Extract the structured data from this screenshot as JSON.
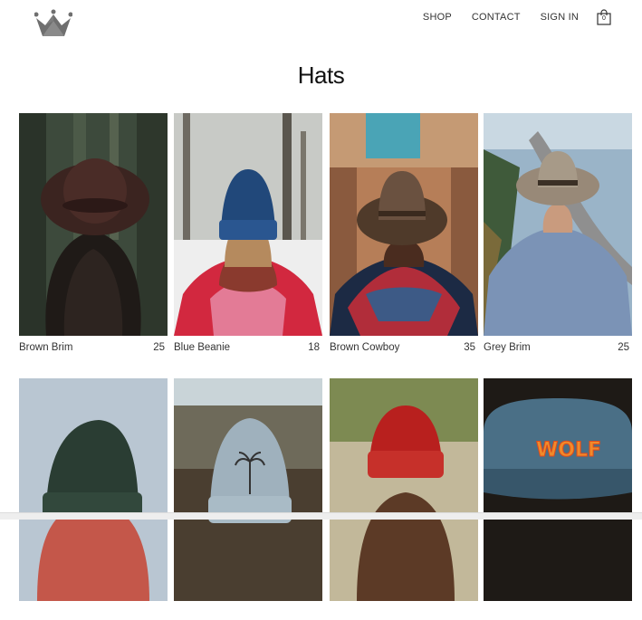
{
  "header": {
    "nav": [
      "SHOP",
      "CONTACT",
      "SIGN IN"
    ],
    "cart_count": "0",
    "logo_icon": "crown-icon",
    "cart_icon": "shopping-bag-icon"
  },
  "page": {
    "title": "Hats"
  },
  "products": [
    {
      "name": "Brown Brim",
      "price": "25"
    },
    {
      "name": "Blue Beanie",
      "price": "18"
    },
    {
      "name": "Brown Cowboy",
      "price": "35"
    },
    {
      "name": "Grey Brim",
      "price": "25"
    },
    {
      "name": "",
      "price": ""
    },
    {
      "name": "",
      "price": ""
    },
    {
      "name": "",
      "price": ""
    },
    {
      "name": "",
      "price": ""
    }
  ],
  "photo_text": {
    "wolf_cap": "WOLF"
  },
  "colors": {
    "logo": "#6f6f6f",
    "text": "#333333",
    "background": "#ffffff"
  }
}
